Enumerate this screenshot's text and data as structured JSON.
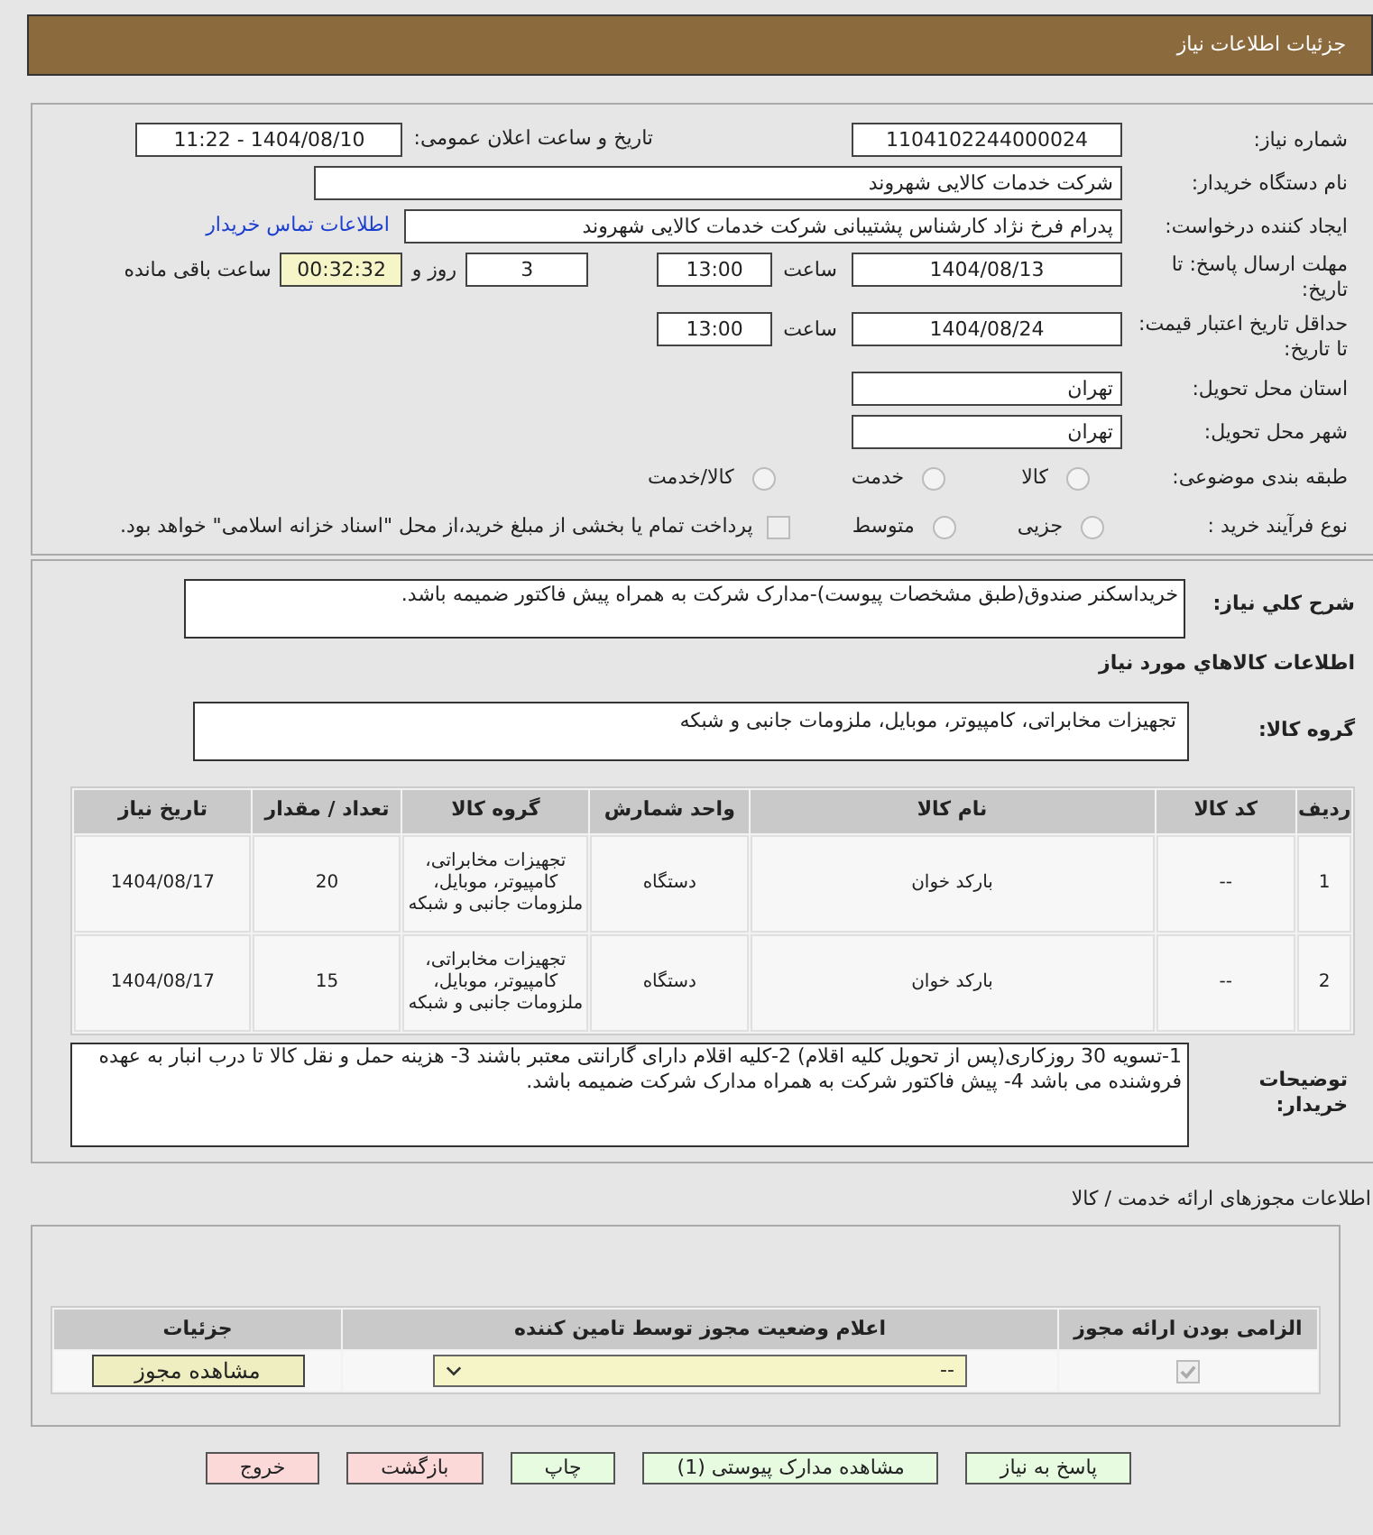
{
  "header": {
    "title": "جزئیات اطلاعات نیاز"
  },
  "need_number": {
    "label": "شماره نیاز:",
    "value": "1104102244000024"
  },
  "announce": {
    "label": "تاریخ و ساعت اعلان عمومی:",
    "value": "1404/08/10 - 11:22"
  },
  "buyer_org": {
    "label": "نام دستگاه خریدار:",
    "value": "شرکت خدمات کالایی شهروند"
  },
  "requester": {
    "label": "ایجاد کننده درخواست:",
    "value": "پدرام فرخ نژاد کارشناس پشتیبانی شرکت خدمات کالایی شهروند",
    "link": "اطلاعات تماس خریدار"
  },
  "deadline": {
    "label": "مهلت ارسال پاسخ: تا تاریخ:",
    "date": "1404/08/13",
    "time_label": "ساعت",
    "time": "13:00",
    "days": "3",
    "days_label": "روز و",
    "remaining": "00:32:32",
    "remaining_label": "ساعت باقی مانده"
  },
  "validity": {
    "label": "حداقل تاریخ اعتبار قیمت: تا تاریخ:",
    "date": "1404/08/24",
    "time_label": "ساعت",
    "time": "13:00"
  },
  "province": {
    "label": "استان محل تحویل:",
    "value": "تهران"
  },
  "city": {
    "label": "شهر محل تحویل:",
    "value": "تهران"
  },
  "category": {
    "label": "طبقه بندی موضوعی:",
    "options": [
      {
        "label": "کالا",
        "selected": false
      },
      {
        "label": "خدمت",
        "selected": false
      },
      {
        "label": "کالا/خدمت",
        "selected": false
      }
    ]
  },
  "process": {
    "label": "نوع فرآیند خرید :",
    "options": [
      {
        "label": "جزیی",
        "selected": false
      },
      {
        "label": "متوسط",
        "selected": false
      }
    ],
    "payment": {
      "label": "پرداخت تمام یا بخشی از مبلغ خرید،از محل \"اسناد خزانه اسلامی\" خواهد بود.",
      "checked": false
    }
  },
  "description": {
    "label": "شرح کلي نياز:",
    "value": "خریداسکنر صندوق(طبق مشخصات پیوست)-مدارک شرکت به همراه پیش فاکتور ضمیمه باشد."
  },
  "goods_heading": "اطلاعات کالاهاي مورد نياز",
  "goods_group": {
    "label": "گروه کالا:",
    "value": "تجهیزات مخابراتی، کامپیوتر، موبایل، ملزومات جانبی و شبکه"
  },
  "items_table": {
    "columns": [
      "ردیف",
      "کد کالا",
      "نام کالا",
      "واحد شمارش",
      "گروه کالا",
      "تعداد / مقدار",
      "تاریخ نیاز"
    ],
    "rows": [
      [
        "1",
        "--",
        "بارکد خوان",
        "دستگاه",
        "تجهیزات مخابراتی، کامپیوتر، موبایل، ملزومات جانبی و شبکه",
        "20",
        "1404/08/17"
      ],
      [
        "2",
        "--",
        "بارکد خوان",
        "دستگاه",
        "تجهیزات مخابراتی، کامپیوتر، موبایل، ملزومات جانبی و شبکه",
        "15",
        "1404/08/17"
      ]
    ]
  },
  "buyer_notes": {
    "label": "توضیحات خریدار:",
    "value": "1-تسویه 30 روزکاری(پس از تحویل کلیه اقلام) 2-کلیه اقلام دارای گارانتی معتبر باشند 3- هزینه حمل و نقل کالا تا درب انبار به عهده فروشنده می باشد 4- پیش فاکتور شرکت به همراه مدارک شرکت ضمیمه باشد."
  },
  "licenses": {
    "title": "اطلاعات مجوزهای ارائه خدمت / کالا",
    "columns": [
      "الزامی بودن ارائه مجوز",
      "اعلام وضعیت مجوز توسط تامین کننده",
      "جزئیات"
    ],
    "rows": [
      {
        "required": true,
        "status": "--",
        "action": "مشاهده مجوز"
      }
    ]
  },
  "buttons": [
    {
      "label": "پاسخ به نیاز",
      "color": "#e6fbe0"
    },
    {
      "label": "مشاهده مدارک پیوستی (1)",
      "color": "#e6fbe0"
    },
    {
      "label": "چاپ",
      "color": "#e6fbe0"
    },
    {
      "label": "بازگشت",
      "color": "#fcd9d9"
    },
    {
      "label": "خروج",
      "color": "#fcd9d9"
    }
  ]
}
